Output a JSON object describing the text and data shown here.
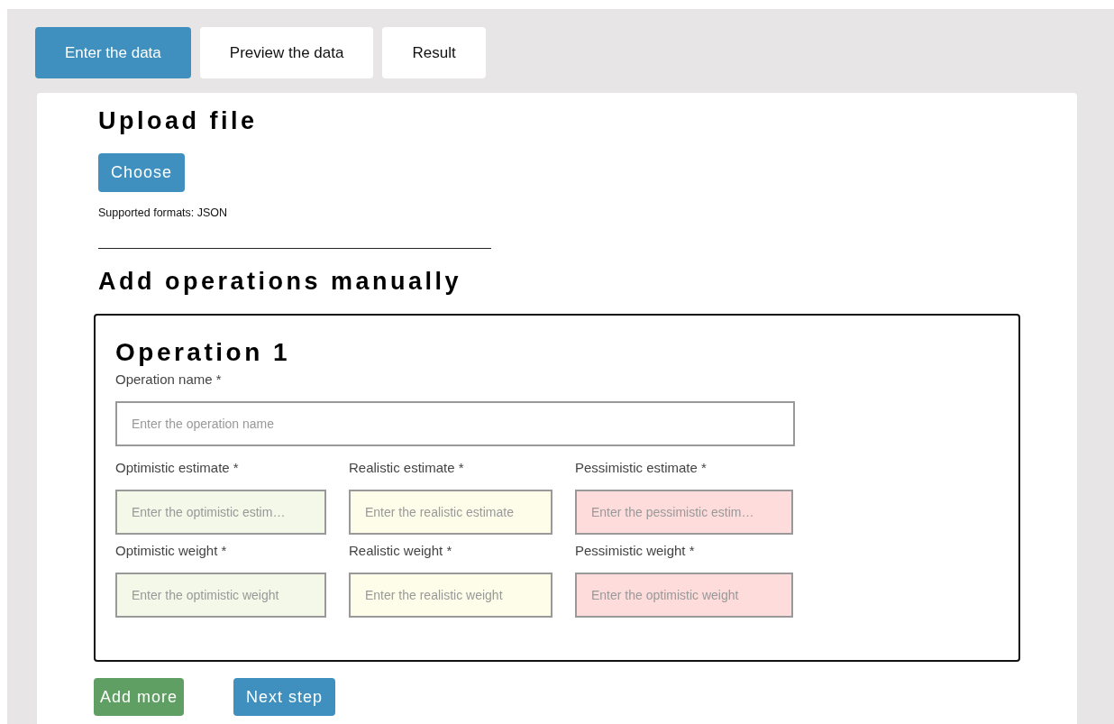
{
  "tabs": [
    {
      "label": "Enter the data",
      "selected": true
    },
    {
      "label": "Preview the data",
      "selected": false
    },
    {
      "label": "Result",
      "selected": false
    }
  ],
  "upload": {
    "title": "Upload file",
    "button": "Choose",
    "note": "Supported formats: JSON"
  },
  "manual": {
    "title": "Add operations manually"
  },
  "operation": {
    "title": "Operation 1",
    "name_field": {
      "label": "Operation name *",
      "placeholder": "Enter the operation name"
    },
    "estimate_fields": [
      {
        "label": "Optimistic estimate *",
        "placeholder": "Enter the optimistic estim…",
        "color": "#f3f8e8"
      },
      {
        "label": "Realistic estimate *",
        "placeholder": "Enter the realistic estimate",
        "color": "#fefdea"
      },
      {
        "label": "Pessimistic estimate *",
        "placeholder": "Enter the pessimistic estim…",
        "color": "#fedcdb"
      }
    ],
    "weight_fields": [
      {
        "label": "Optimistic weight *",
        "placeholder": "Enter the optimistic weight",
        "color": "#f3f8e8"
      },
      {
        "label": "Realistic weight *",
        "placeholder": "Enter the realistic weight",
        "color": "#fefdea"
      },
      {
        "label": "Pessimistic weight *",
        "placeholder": "Enter the optimistic weight",
        "color": "#fedcdb"
      }
    ]
  },
  "buttons": [
    {
      "label": "Add more",
      "kind": "add"
    },
    {
      "label": "Next step",
      "kind": "next"
    }
  ]
}
